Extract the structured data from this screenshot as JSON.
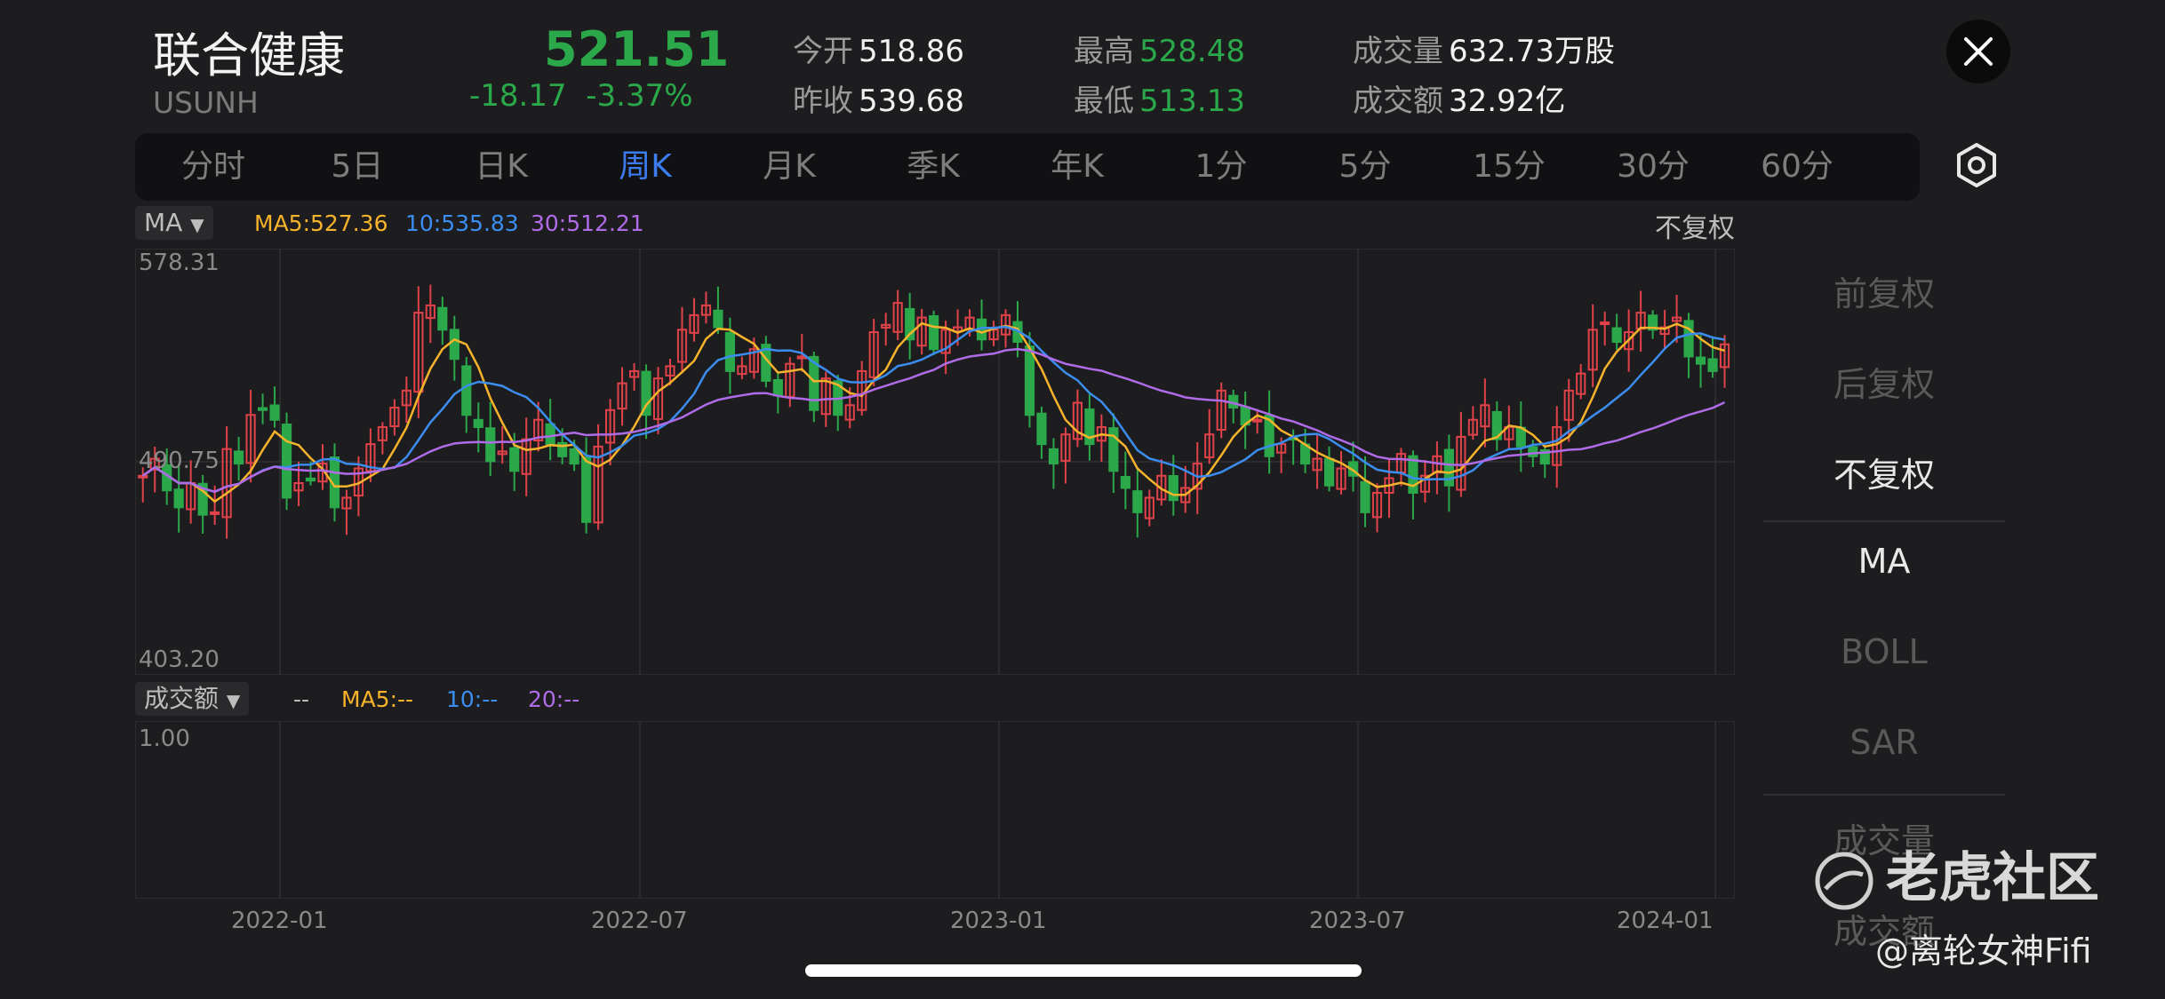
{
  "header": {
    "name": "联合健康",
    "symbol": "USUNH",
    "price": "521.51",
    "change": "-18.17",
    "change_pct": "-3.37%",
    "stats": {
      "open_label": "今开",
      "open": "518.86",
      "prev_label": "昨收",
      "prev": "539.68",
      "high_label": "最高",
      "high": "528.48",
      "low_label": "最低",
      "low": "513.13",
      "vol_label": "成交量",
      "vol": "632.73万股",
      "amt_label": "成交额",
      "amt": "32.92亿"
    }
  },
  "tabs": [
    "分时",
    "5日",
    "日K",
    "周K",
    "月K",
    "季K",
    "年K",
    "1分",
    "5分",
    "15分",
    "30分",
    "60分"
  ],
  "active_tab": "周K",
  "indicator": {
    "main_selector": "MA",
    "ma5": "MA5:527.36",
    "ma10": "10:535.83",
    "ma30": "30:512.21",
    "vol_selector": "成交额",
    "vol_dash": "--",
    "vol_ma5": "MA5:--",
    "vol_ma10": "10:--",
    "vol_ma20": "20:--",
    "adjust": "不复权"
  },
  "colors": {
    "up": "#e0424a",
    "down": "#2aa84a",
    "ma5": "#f6b32b",
    "ma10": "#3b8df0",
    "ma30": "#b06be8"
  },
  "chart_data": {
    "type": "candlestick",
    "y_axis_labels": [
      "578.31",
      "490.75",
      "403.20"
    ],
    "ylim": [
      403.2,
      578.31
    ],
    "vol_axis_label": "1.00",
    "x_tick_labels": [
      "2022-01",
      "2022-07",
      "2023-01",
      "2023-07",
      "2024-01"
    ],
    "close": [
      485,
      492,
      479,
      472,
      482,
      469,
      470,
      496,
      490,
      510,
      512,
      508,
      476,
      482,
      483,
      490,
      472,
      476,
      488,
      498,
      505,
      513,
      520,
      552,
      555,
      545,
      533,
      510,
      505,
      491,
      495,
      487,
      500,
      508,
      498,
      493,
      490,
      466,
      497,
      512,
      523,
      528,
      510,
      525,
      530,
      545,
      551,
      555,
      546,
      528,
      530,
      537,
      524,
      518,
      531,
      534,
      512,
      525,
      510,
      514,
      528,
      544,
      547,
      556,
      541,
      550,
      537,
      545,
      546,
      550,
      541,
      545,
      551,
      540,
      510,
      498,
      490,
      502,
      515,
      498,
      505,
      487,
      480,
      470,
      476,
      485,
      475,
      480,
      490,
      502,
      520,
      513,
      506,
      508,
      493,
      498,
      500,
      490,
      492,
      481,
      488,
      485,
      470,
      478,
      484,
      494,
      478,
      485,
      493,
      481,
      501,
      508,
      514,
      500,
      505,
      497,
      493,
      490,
      505,
      520,
      527,
      545,
      548,
      540,
      544,
      552,
      545,
      546,
      550,
      534,
      531,
      528,
      539
    ],
    "ma5_last": 527.36,
    "ma10_last": 535.83,
    "ma30_last": 512.21
  },
  "menu": {
    "items": [
      "前复权",
      "后复权",
      "不复权",
      "MA",
      "BOLL",
      "SAR",
      "成交量",
      "成交额"
    ],
    "active_adjust": "不复权",
    "active_indicator": "MA"
  },
  "watermark": "老虎社区",
  "author": "@离轮女神Fifi"
}
